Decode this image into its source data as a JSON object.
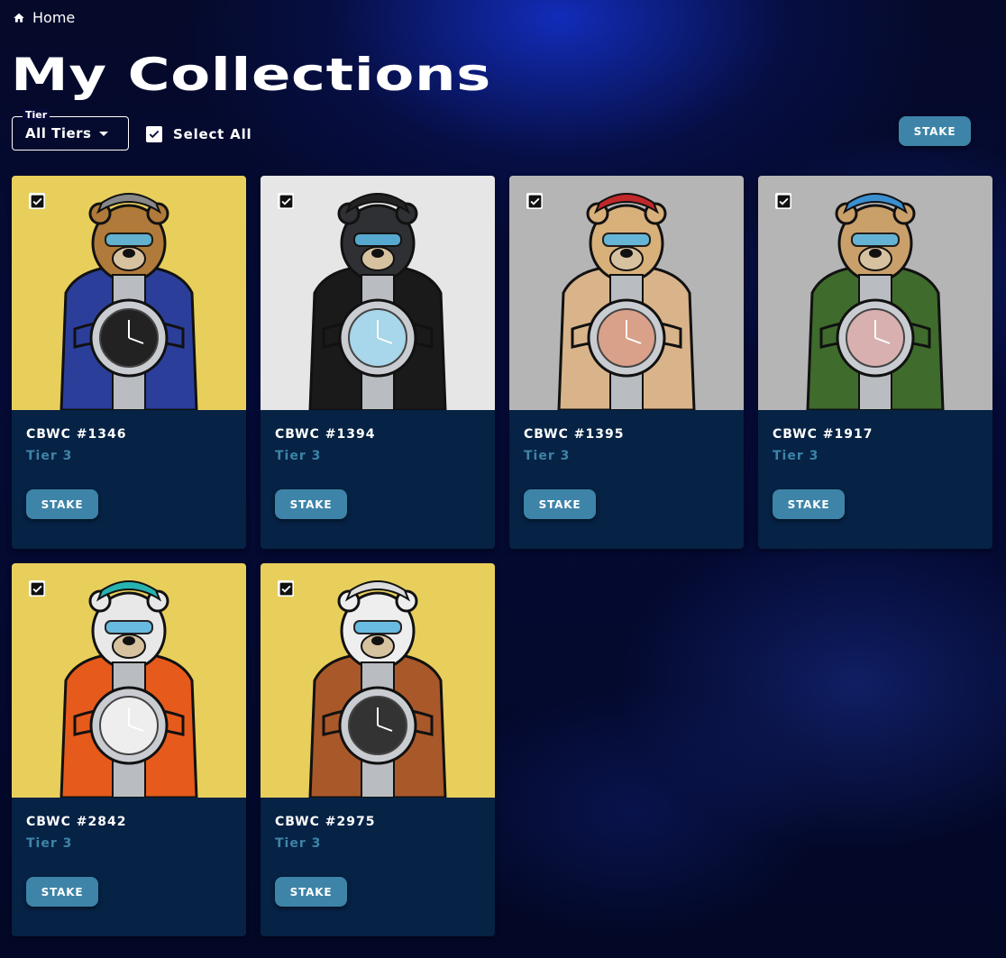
{
  "breadcrumb": {
    "home_label": "Home",
    "icon": "home-icon"
  },
  "page_title": "My Collections",
  "filter": {
    "tier_legend": "Tier",
    "tier_value": "All Tiers",
    "select_all_label": "Select All",
    "select_all_checked": true
  },
  "toolbar": {
    "stake_label": "STAKE"
  },
  "colors": {
    "accent": "#3d84a8",
    "card_bg": "#062244"
  },
  "cards": [
    {
      "name": "CBWC #1346",
      "tier": "Tier 3",
      "stake_label": "STAKE",
      "checked": true,
      "bg": "#e8cf5c"
    },
    {
      "name": "CBWC #1394",
      "tier": "Tier 3",
      "stake_label": "STAKE",
      "checked": true,
      "bg": "#e6e6e6"
    },
    {
      "name": "CBWC #1395",
      "tier": "Tier 3",
      "stake_label": "STAKE",
      "checked": true,
      "bg": "#b5b5b5"
    },
    {
      "name": "CBWC #1917",
      "tier": "Tier 3",
      "stake_label": "STAKE",
      "checked": true,
      "bg": "#b5b5b5"
    },
    {
      "name": "CBWC #2842",
      "tier": "Tier 3",
      "stake_label": "STAKE",
      "checked": true,
      "bg": "#e8cf5c"
    },
    {
      "name": "CBWC #2975",
      "tier": "Tier 3",
      "stake_label": "STAKE",
      "checked": true,
      "bg": "#e8cf5c"
    }
  ]
}
